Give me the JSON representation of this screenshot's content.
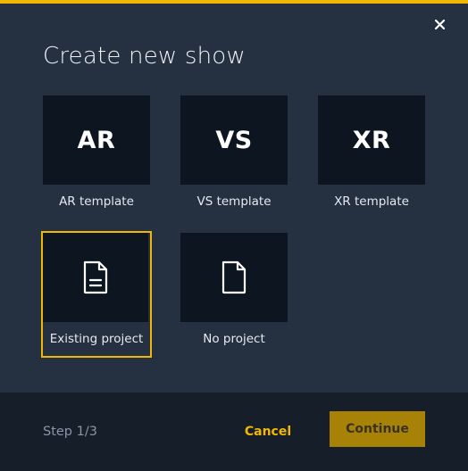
{
  "dialog": {
    "title": "Create new show",
    "accent_color": "#f2b705",
    "close_icon": "close-icon"
  },
  "templates": [
    {
      "thumb": "AR",
      "label": "AR template"
    },
    {
      "thumb": "VS",
      "label": "VS template"
    },
    {
      "thumb": "XR",
      "label": "XR template"
    }
  ],
  "projects": [
    {
      "icon": "document-icon",
      "label": "Existing project",
      "selected": true
    },
    {
      "icon": "blank-file-icon",
      "label": "No project",
      "selected": false
    }
  ],
  "footer": {
    "step": "Step 1/3",
    "cancel_label": "Cancel",
    "continue_label": "Continue"
  }
}
